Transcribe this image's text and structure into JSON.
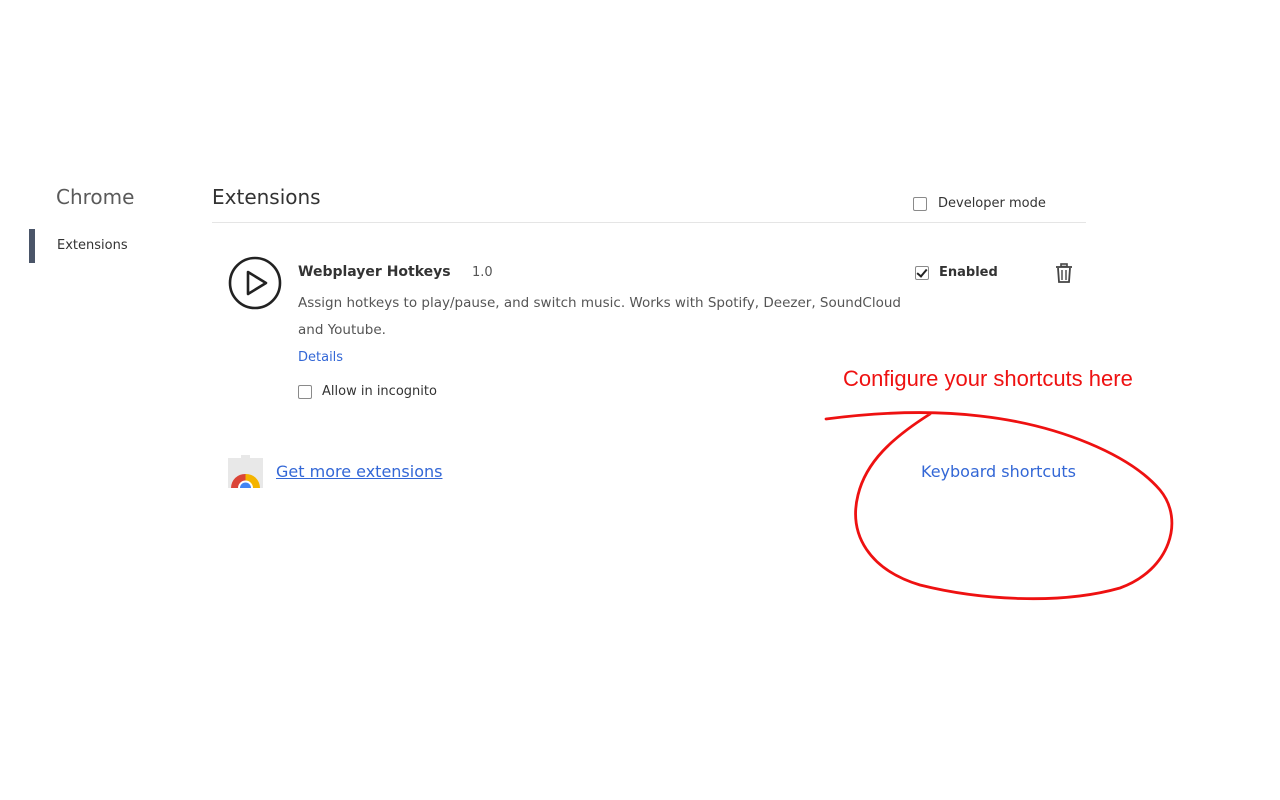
{
  "sidebar": {
    "title": "Chrome",
    "items": [
      {
        "label": "Extensions",
        "selected": true
      }
    ]
  },
  "header": {
    "title": "Extensions",
    "developer_mode_label": "Developer mode",
    "developer_mode_checked": false
  },
  "extension": {
    "name": "Webplayer Hotkeys",
    "version": "1.0",
    "description": "Assign hotkeys to play/pause, and switch music. Works with Spotify, Deezer, SoundCloud and Youtube.",
    "details_label": "Details",
    "incognito_label": "Allow in incognito",
    "incognito_checked": false,
    "enabled_label": "Enabled",
    "enabled_checked": true,
    "icon": "play-circle-icon"
  },
  "footer": {
    "get_more_label": "Get more extensions",
    "keyboard_shortcuts_label": "Keyboard shortcuts"
  },
  "annotation": {
    "text": "Configure your shortcuts here",
    "color": "#ee1111"
  },
  "colors": {
    "link": "#3367d6",
    "sidebar_accent": "#4a5568"
  }
}
